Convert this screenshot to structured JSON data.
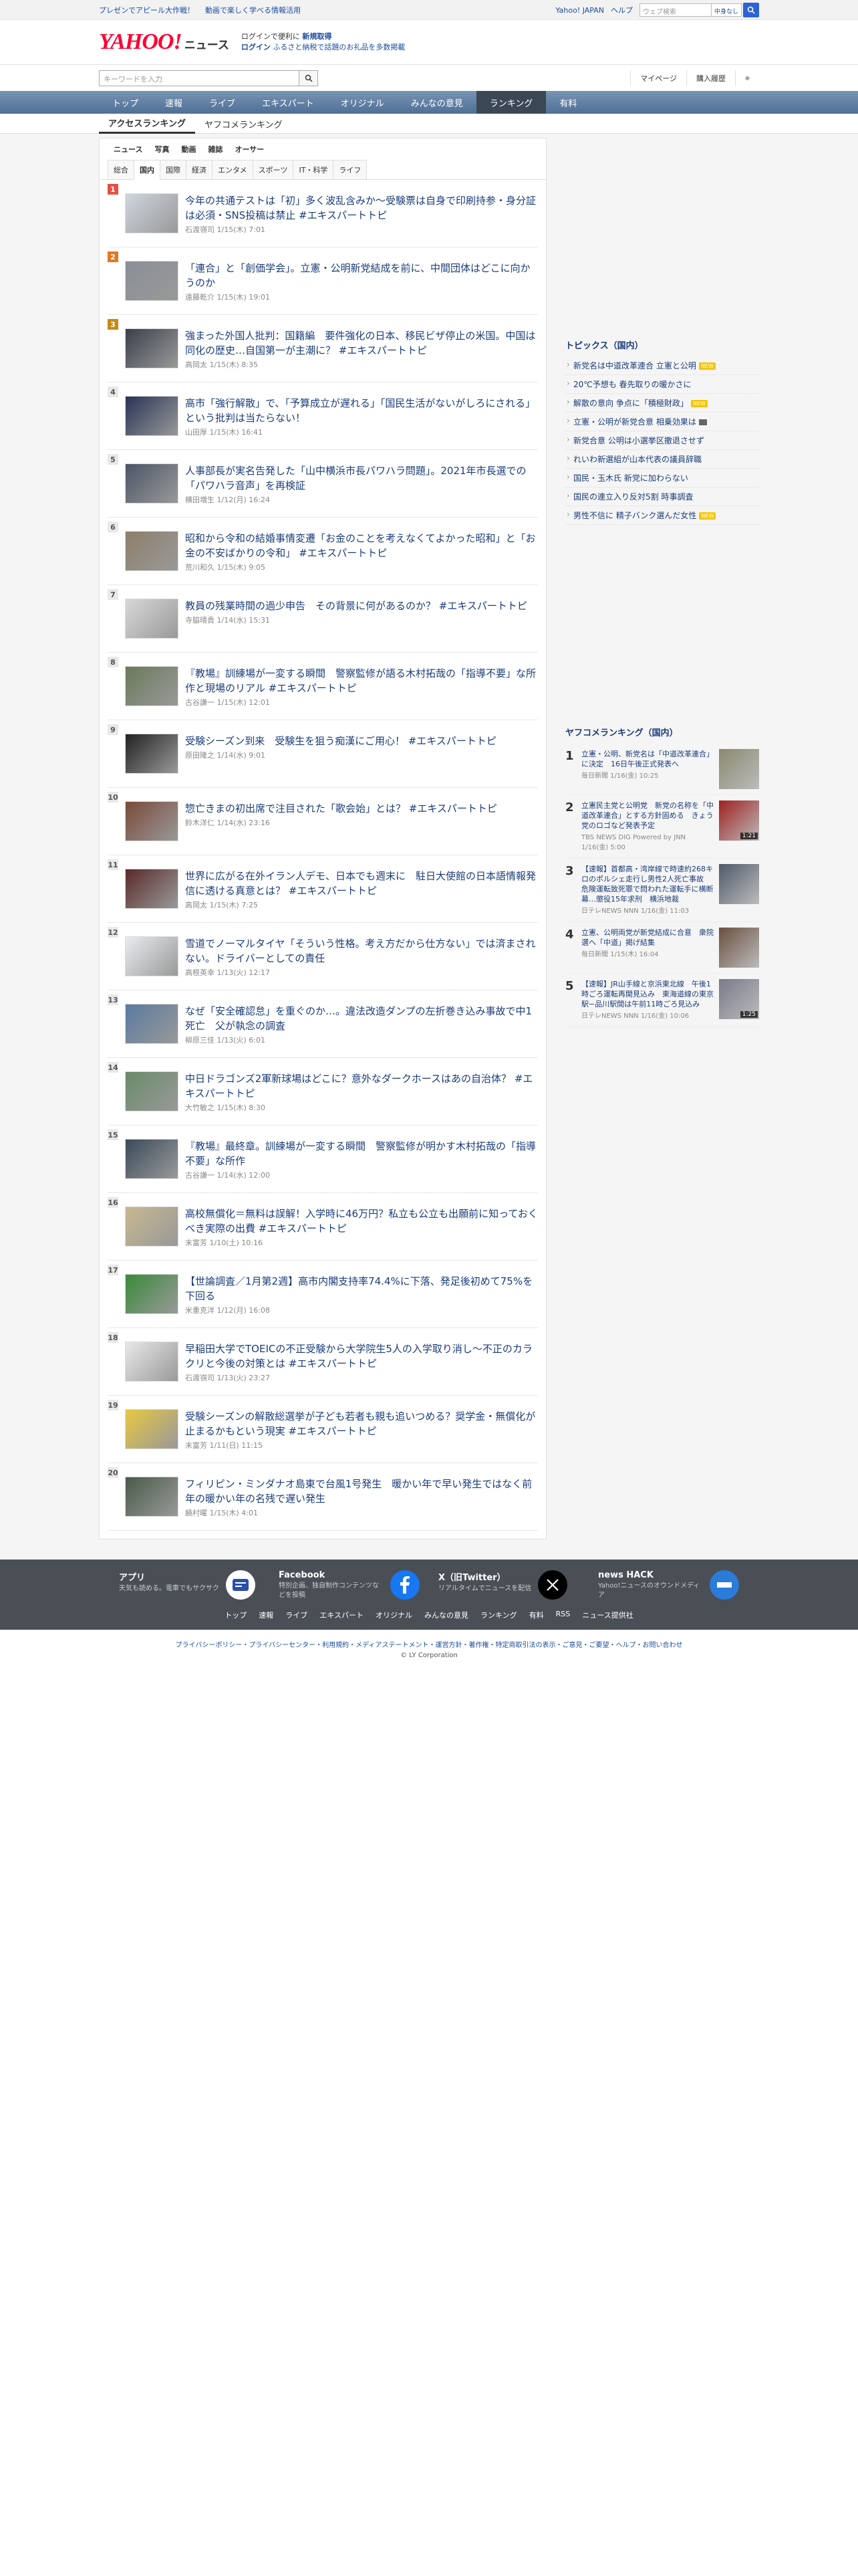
{
  "topbar": {
    "promo": "プレゼンでアピール大作戦！",
    "promo2": "動画で楽しく学べる情報活用",
    "yahoo_link": "Yahoo! JAPAN",
    "help": "ヘルプ",
    "web_search_placeholder": "ウェブ検索",
    "mode": "中身なし"
  },
  "header": {
    "logo": "YAHOO!",
    "logo_sub": "JAPAN",
    "service": "ニュース",
    "msg_line1_prefix": "ログインで便利に",
    "msg_line1_bold": "新規取得",
    "msg_line2_login": "ログイン",
    "msg_line2_rest": "ふるさと納税で話題のお礼品を多数掲載"
  },
  "search": {
    "placeholder": "キーワードを入力",
    "mypage": "マイページ",
    "history": "購入履歴"
  },
  "gnav": [
    "トップ",
    "速報",
    "ライブ",
    "エキスパート",
    "オリジナル",
    "みんなの意見",
    "ランキング",
    "有料"
  ],
  "subtabs": [
    "アクセスランキング",
    "ヤフコメランキング"
  ],
  "cat_row1": [
    "ニュース",
    "写真",
    "動画",
    "雑誌",
    "オーサー"
  ],
  "cat_row2": [
    "総合",
    "国内",
    "国際",
    "経済",
    "エンタメ",
    "スポーツ",
    "IT・科学",
    "ライフ"
  ],
  "ranking": [
    {
      "n": "1",
      "title": "今年の共通テストは「初」多く波乱含みか〜受験票は自身で印刷持参・身分証は必須・SNS投稿は禁止 #エキスパートトピ",
      "meta": "石渡嶺司  1/15(木) 7:01"
    },
    {
      "n": "2",
      "title": "「連合」と「創価学会」。立憲・公明新党結成を前に、中間団体はどこに向かうのか",
      "meta": "遠藤乾介  1/15(木) 19:01"
    },
    {
      "n": "3",
      "title": "強まった外国人批判：国籍編　要件強化の日本、移民ビザ停止の米国。中国は同化の歴史…自国第一が主潮に？ #エキスパートトピ",
      "meta": "高岡太  1/15(木) 8:35"
    },
    {
      "n": "4",
      "title": "高市「強行解散」で、「予算成立が遅れる」「国民生活がないがしろにされる」という批判は当たらない！",
      "meta": "山田厚  1/15(木) 16:41"
    },
    {
      "n": "5",
      "title": "人事部長が実名告発した「山中横浜市長パワハラ問題」。2021年市長選での「パワハラ音声」を再検証",
      "meta": "横田増生  1/12(月) 16:24"
    },
    {
      "n": "6",
      "title": "昭和から令和の結婚事情変遷「お金のことを考えなくてよかった昭和」と「お金の不安ばかりの令和」 #エキスパートトピ",
      "meta": "荒川和久  1/15(木) 9:05"
    },
    {
      "n": "7",
      "title": "教員の残業時間の過少申告　その背景に何があるのか？ #エキスパートトピ",
      "meta": "寺脇晴貴  1/14(水) 15:31"
    },
    {
      "n": "8",
      "title": "『教場』訓練場が一変する瞬間　警察監修が語る木村拓哉の「指導不要」な所作と現場のリアル #エキスパートトピ",
      "meta": "古谷謙一  1/15(木) 12:01"
    },
    {
      "n": "9",
      "title": "受験シーズン到来　受験生を狙う痴漢にご用心！ #エキスパートトピ",
      "meta": "原田隆之  1/14(水) 9:01"
    },
    {
      "n": "10",
      "title": "惣亡きまの初出席で注目された「歌会始」とは？ #エキスパートトピ",
      "meta": "鈴木洋仁  1/14(水) 23:16"
    },
    {
      "n": "11",
      "title": "世界に広がる在外イラン人デモ、日本でも週末に　駐日大使館の日本語情報発信に透ける真意とは？ #エキスパートトピ",
      "meta": "高岡太  1/15(木) 7:25"
    },
    {
      "n": "12",
      "title": "雪道でノーマルタイヤ「そういう性格。考え方だから仕方ない」では済まされない。ドライバーとしての責任",
      "meta": "高根英幸  1/13(火) 12:17"
    },
    {
      "n": "13",
      "title": "なぜ「安全確認怠」を重ぐのか…。違法改造ダンプの左折巻き込み事故で中1死亡　父が執念の調査",
      "meta": "柳原三佳  1/13(火) 6:01"
    },
    {
      "n": "14",
      "title": "中日ドラゴンズ2軍新球場はどこに？意外なダークホースはあの自治体？ #エキスパートトピ",
      "meta": "大竹敏之  1/15(木) 8:30"
    },
    {
      "n": "15",
      "title": "『教場』最終章。訓練場が一変する瞬間　警察監修が明かす木村拓哉の「指導不要」な所作",
      "meta": "古谷謙一  1/14(水) 12:00"
    },
    {
      "n": "16",
      "title": "高校無償化＝無料は誤解！入学時に46万円？私立も公立も出願前に知っておくべき実際の出費 #エキスパートトピ",
      "meta": "末富芳  1/10(土) 10:16"
    },
    {
      "n": "17",
      "title": "【世論調査／1月第2週】高市内閣支持率74.4%に下落、発足後初めて75%を下回る",
      "meta": "米重克洋  1/12(月) 16:08"
    },
    {
      "n": "18",
      "title": "早稲田大学でTOEICの不正受験から大学院生5人の入学取り消し〜不正のカラクリと今後の対策とは #エキスパートトピ",
      "meta": "石渡嶺司  1/13(火) 23:27"
    },
    {
      "n": "19",
      "title": "受験シーズンの解散総選挙が子ども若者も親も追いつめる？奨学金・無償化が止まるかもという現実 #エキスパートトピ",
      "meta": "末富芳  1/11(日) 11:15"
    },
    {
      "n": "20",
      "title": "フィリピン・ミンダナオ島東で台風1号発生　暖かい年で早い発生ではなく前年の暖かい年の名残で遅い発生",
      "meta": "饒村曜  1/15(木) 4:01"
    }
  ],
  "topics": {
    "heading": "トピックス（国内）",
    "items": [
      {
        "t": "新党名は中道改革連合 立憲と公明",
        "badge": "new"
      },
      {
        "t": "20℃予想も 春先取りの暖かさに",
        "badge": ""
      },
      {
        "t": "解散の意向 争点に「積極財政」",
        "badge": "new"
      },
      {
        "t": "立憲・公明が新党合意 相乗効果は",
        "badge": "pic"
      },
      {
        "t": "新党合意 公明は小選挙区撤退させず",
        "badge": ""
      },
      {
        "t": "れいわ新選組が山本代表の議員辞職",
        "badge": ""
      },
      {
        "t": "国民・玉木氏 新党に加わらない",
        "badge": ""
      },
      {
        "t": "国民の連立入り反対5割 時事調査",
        "badge": ""
      },
      {
        "t": "男性不信に 精子バンク選んだ女性",
        "badge": "new"
      }
    ]
  },
  "yrank": {
    "heading": "ヤフコメランキング（国内）",
    "items": [
      {
        "n": "1",
        "t": "立憲・公明、新党名は「中道改革連合」に決定　16日午後正式発表へ",
        "s": "毎日新聞 1/16(金) 10:25",
        "dur": ""
      },
      {
        "n": "2",
        "t": "立憲民主党と公明党　新党の名称を「中道改革連合」とする方針固める　きょう党のロゴなど発表予定",
        "s": "TBS NEWS DIG Powered by JNN 1/16(金) 5:00",
        "dur": "1:21"
      },
      {
        "n": "3",
        "t": "【速報】首都高・湾岸線で時速約268キロのポルシェ走行し男性2人死亡事故　危険運転致死罪で問われた運転手に横断幕…懲役15年求刑　横浜地裁",
        "s": "日テレNEWS NNN 1/16(金) 11:03",
        "dur": ""
      },
      {
        "n": "4",
        "t": "立憲、公明両党が新党結成に合意　衆院選へ「中道」掲げ結集",
        "s": "毎日新聞 1/15(木) 16:04",
        "dur": ""
      },
      {
        "n": "5",
        "t": "【速報】JR山手線と京浜東北線　午後1時ごろ運転再開見込み　東海道線の東京駅−品川駅間は午前11時ごろ見込み",
        "s": "日テレNEWS NNN 1/16(金) 10:06",
        "dur": "1:25"
      }
    ]
  },
  "apps": [
    {
      "ttl": "アプリ",
      "desc": "天気も読める。電車でもサクサク"
    },
    {
      "ttl": "Facebook",
      "desc": "特別企画、独自制作コンテンツなどを投稿"
    },
    {
      "ttl": "X（旧Twitter）",
      "desc": "リアルタイムでニュースを配信"
    },
    {
      "ttl": "news HACK",
      "desc": "Yahoo!ニュースのオウンドメディア"
    }
  ],
  "ft_links": [
    "トップ",
    "速報",
    "ライブ",
    "エキスパート",
    "オリジナル",
    "みんなの意見",
    "ランキング",
    "有料",
    "RSS",
    "ニュース提供社"
  ],
  "legal": "プライバシーポリシー・プライバシーセンター・利用規約・メディアステートメント・運営方針・著作権・特定商取引法の表示・ご意見・ご要望・ヘルプ・お問い合わせ",
  "copyright": "© LY Corporation"
}
